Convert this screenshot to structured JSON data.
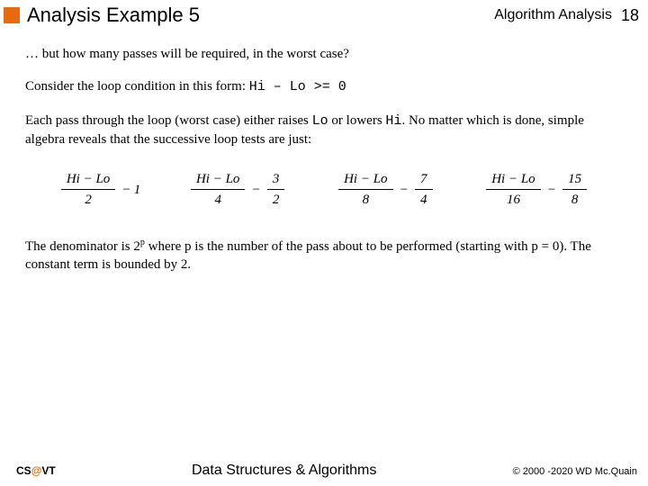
{
  "header": {
    "title": "Analysis Example 5",
    "topic": "Algorithm Analysis",
    "page": "18"
  },
  "body": {
    "p1": "… but how many passes will be required, in the worst case?",
    "p2a": "Consider the loop condition in this form:  ",
    "p2code": "Hi – Lo >= 0",
    "p3a": "Each pass through the loop (worst case) either raises ",
    "p3code1": "Lo",
    "p3b": " or lowers ",
    "p3code2": "Hi",
    "p3c": ".  No matter which is done, simple algebra reveals that the successive loop tests are just:",
    "p4a": "The denominator is 2",
    "p4sup": "p",
    "p4b": " where p is the number of the pass about to be performed (starting with p = 0).  The constant term is bounded by 2."
  },
  "formulas": {
    "numexpr": "Hi − Lo",
    "t1": {
      "den": "2",
      "sub_num": "1",
      "sub_den": ""
    },
    "t2": {
      "den": "4",
      "sub_num": "3",
      "sub_den": "2"
    },
    "t3": {
      "den": "8",
      "sub_num": "7",
      "sub_den": "4"
    },
    "t4": {
      "den": "16",
      "sub_num": "15",
      "sub_den": "8"
    }
  },
  "footer": {
    "logo1": "CS",
    "logo_at": "@",
    "logo2": "VT",
    "course": "Data Structures & Algorithms",
    "copyright": "© 2000 -2020 WD Mc.Quain"
  }
}
